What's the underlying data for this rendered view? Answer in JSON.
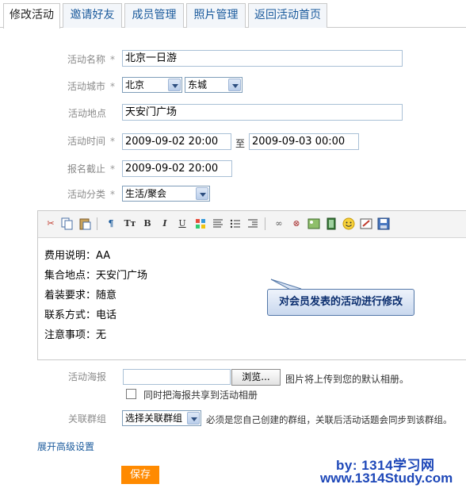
{
  "tabs": [
    "修改活动",
    "邀请好友",
    "成员管理",
    "照片管理",
    "返回活动首页"
  ],
  "form": {
    "name_label": "活动名称",
    "name_value": "北京一日游",
    "city_label": "活动城市",
    "city_value": "北京",
    "district_value": "东城",
    "place_label": "活动地点",
    "place_value": "天安门广场",
    "time_label": "活动时间",
    "time_start": "2009-09-02 20:00",
    "time_to": "至",
    "time_end": "2009-09-03 00:00",
    "deadline_label": "报名截止",
    "deadline_value": "2009-09-02 20:00",
    "category_label": "活动分类",
    "category_value": "生活/聚会",
    "required_mark": "*"
  },
  "editor": {
    "toolbar_icons": [
      "cut-icon",
      "copy-icon",
      "paste-icon",
      "format-icon",
      "font-size-icon",
      "bold-icon",
      "italic-icon",
      "underline-icon",
      "color-icon",
      "align-icon",
      "list-icon",
      "indent-icon",
      "link-icon",
      "unlink-icon",
      "image-icon",
      "video-icon",
      "emoticon-icon",
      "edit-icon",
      "save-icon"
    ],
    "lines": [
      "费用说明：AA",
      "集合地点：天安门广场",
      "着装要求：随意",
      "联系方式：电话",
      "注意事项：无"
    ]
  },
  "callout": "对会员发表的活动进行修改",
  "poster": {
    "label": "活动海报",
    "browse": "浏览...",
    "hint": "图片将上传到您的默认相册。",
    "share_label": "同时把海报共享到活动相册"
  },
  "group": {
    "label": "关联群组",
    "select_value": "选择关联群组",
    "hint": "必须是您自己创建的群组，关联后活动话题会同步到该群组。"
  },
  "advanced_link": "展开高级设置",
  "save_label": "保存",
  "watermark": {
    "line1": "by: 1314学习网",
    "line2": "www.1314Study.com"
  }
}
